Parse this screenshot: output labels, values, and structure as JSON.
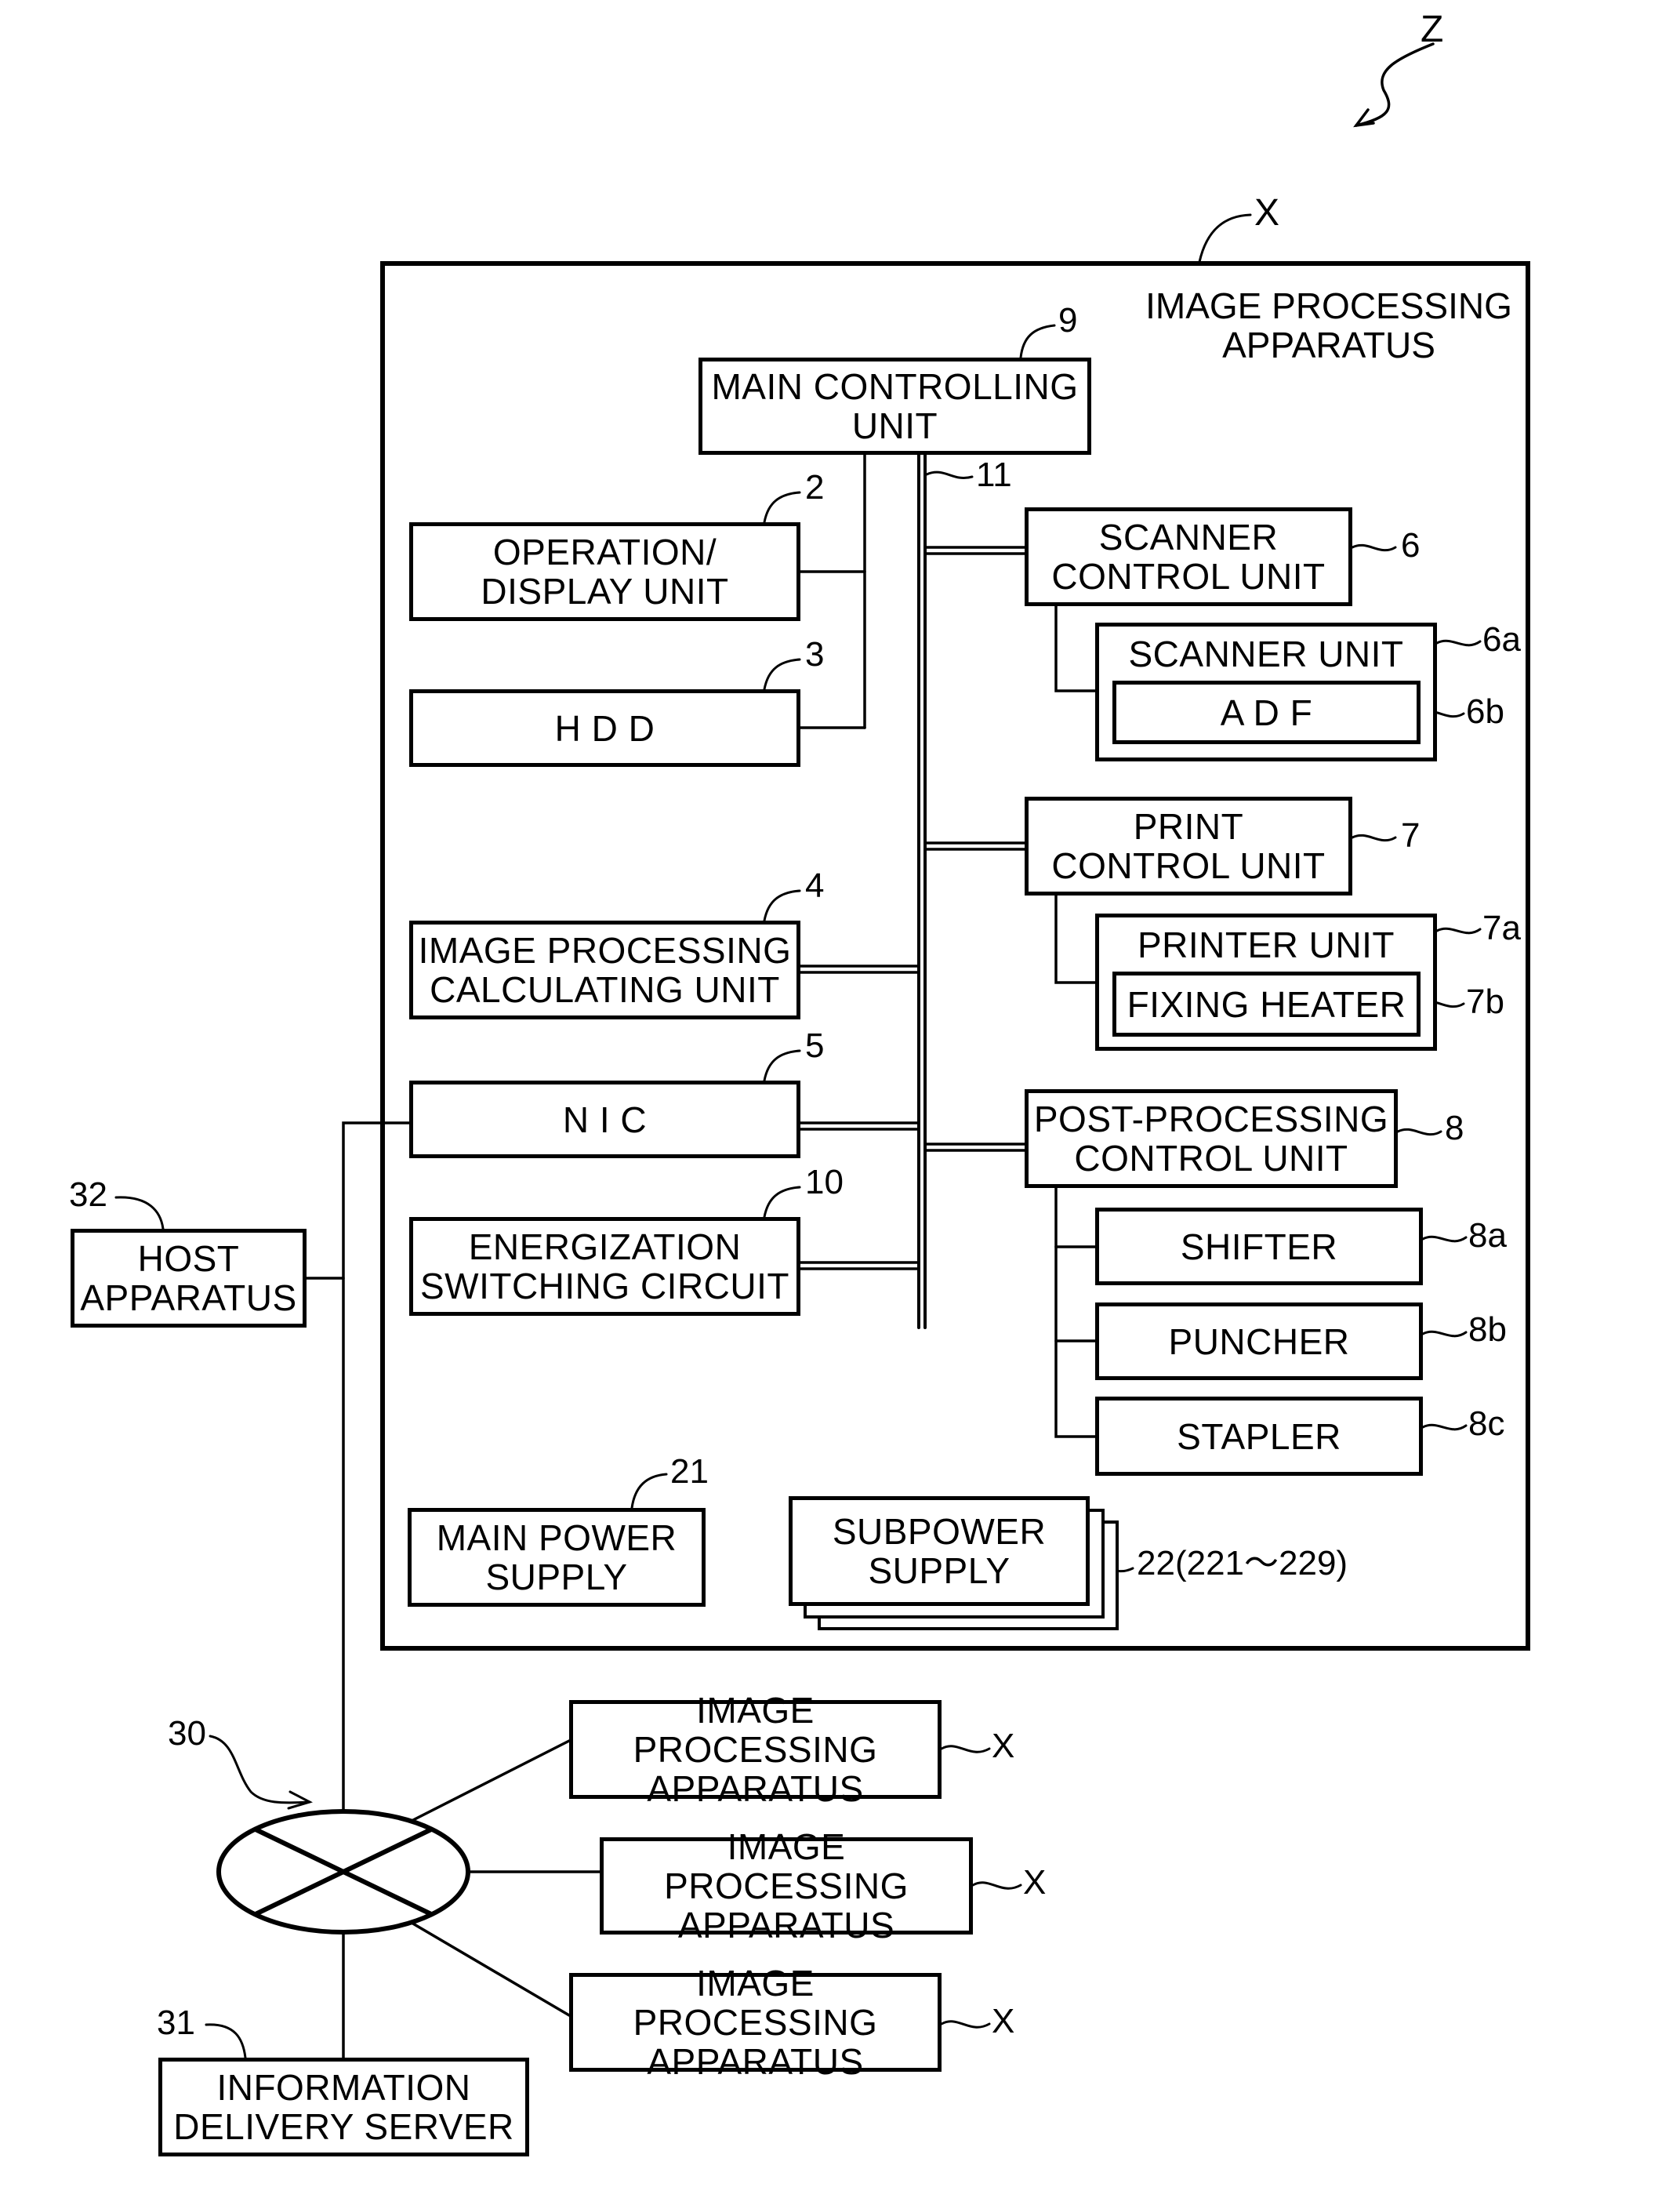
{
  "figure": {
    "system_ref": "Z",
    "apparatus_ref": "X",
    "apparatus_title": "IMAGE PROCESSING\nAPPARATUS"
  },
  "units": {
    "main_controlling": {
      "label": "MAIN CONTROLLING\nUNIT",
      "ref": "9"
    },
    "operation_display": {
      "label": "OPERATION/\nDISPLAY UNIT",
      "ref": "2"
    },
    "hdd": {
      "label": "H D D",
      "ref": "3"
    },
    "image_processing_calculating": {
      "label": "IMAGE PROCESSING\nCALCULATING UNIT",
      "ref": "4"
    },
    "nic": {
      "label": "N I C",
      "ref": "5"
    },
    "energization_switching": {
      "label": "ENERGIZATION\nSWITCHING CIRCUIT",
      "ref": "10"
    },
    "bus": {
      "ref": "11"
    },
    "scanner_control": {
      "label": "SCANNER\nCONTROL UNIT",
      "ref": "6"
    },
    "scanner_unit": {
      "label": "SCANNER UNIT",
      "ref": "6a"
    },
    "adf": {
      "label": "A D F",
      "ref": "6b"
    },
    "print_control": {
      "label": "PRINT\nCONTROL UNIT",
      "ref": "7"
    },
    "printer_unit": {
      "label": "PRINTER UNIT",
      "ref": "7a"
    },
    "fixing_heater": {
      "label": "FIXING HEATER",
      "ref": "7b"
    },
    "post_processing_control": {
      "label": "POST-PROCESSING\nCONTROL UNIT",
      "ref": "8"
    },
    "shifter": {
      "label": "SHIFTER",
      "ref": "8a"
    },
    "puncher": {
      "label": "PUNCHER",
      "ref": "8b"
    },
    "stapler": {
      "label": "STAPLER",
      "ref": "8c"
    },
    "main_power_supply": {
      "label": "MAIN POWER\nSUPPLY",
      "ref": "21"
    },
    "subpower_supply": {
      "label": "SUBPOWER\nSUPPLY",
      "ref": "22(221～229)"
    }
  },
  "external": {
    "host_apparatus": {
      "label": "HOST\nAPPARATUS",
      "ref": "32"
    },
    "network": {
      "ref": "30"
    },
    "information_delivery_server": {
      "label": "INFORMATION\nDELIVERY SERVER",
      "ref": "31"
    },
    "other_apparatuses": [
      {
        "label": "IMAGE PROCESSING\nAPPARATUS",
        "ref": "X"
      },
      {
        "label": "IMAGE PROCESSING\nAPPARATUS",
        "ref": "X"
      },
      {
        "label": "IMAGE PROCESSING\nAPPARATUS",
        "ref": "X"
      }
    ]
  }
}
